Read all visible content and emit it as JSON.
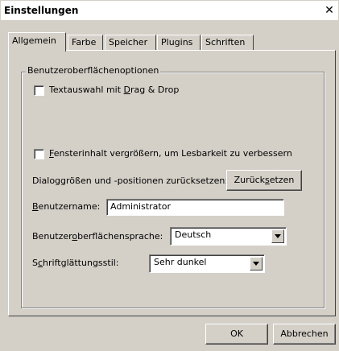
{
  "window": {
    "title": "Einstellungen",
    "close_glyph": "✕"
  },
  "tabs": [
    {
      "label": "Allgemein",
      "active": true
    },
    {
      "label": "Farbe",
      "active": false
    },
    {
      "label": "Speicher",
      "active": false
    },
    {
      "label": "Plugins",
      "active": false
    },
    {
      "label": "Schriften",
      "active": false
    }
  ],
  "group": {
    "label": "Benutzeroberflächenoptionen"
  },
  "options": {
    "drag_drop": {
      "label_pre": "Textauswahl mit ",
      "label_accel": "D",
      "label_post": "rag & Drop",
      "checked": false
    },
    "zoom": {
      "label_pre": "",
      "label_accel": "F",
      "label_post": "ensterinhalt vergrößern, um Lesbarkeit zu verbessern",
      "checked": false
    }
  },
  "reset": {
    "label": "Dialoggrößen und -positionen zurücksetzen:",
    "button_pre": "Zurück",
    "button_accel": "s",
    "button_post": "etzen"
  },
  "username": {
    "label_accel": "B",
    "label_post": "enutzername:",
    "value": "Administrator"
  },
  "language": {
    "label_pre": "Benutzer",
    "label_accel": "o",
    "label_post": "berflächensprache:",
    "value": "Deutsch"
  },
  "smoothing": {
    "label_pre": "S",
    "label_accel": "c",
    "label_post": "hriftglättungsstil:",
    "value": "Sehr dunkel"
  },
  "footer": {
    "ok": "OK",
    "cancel": "Abbrechen"
  }
}
